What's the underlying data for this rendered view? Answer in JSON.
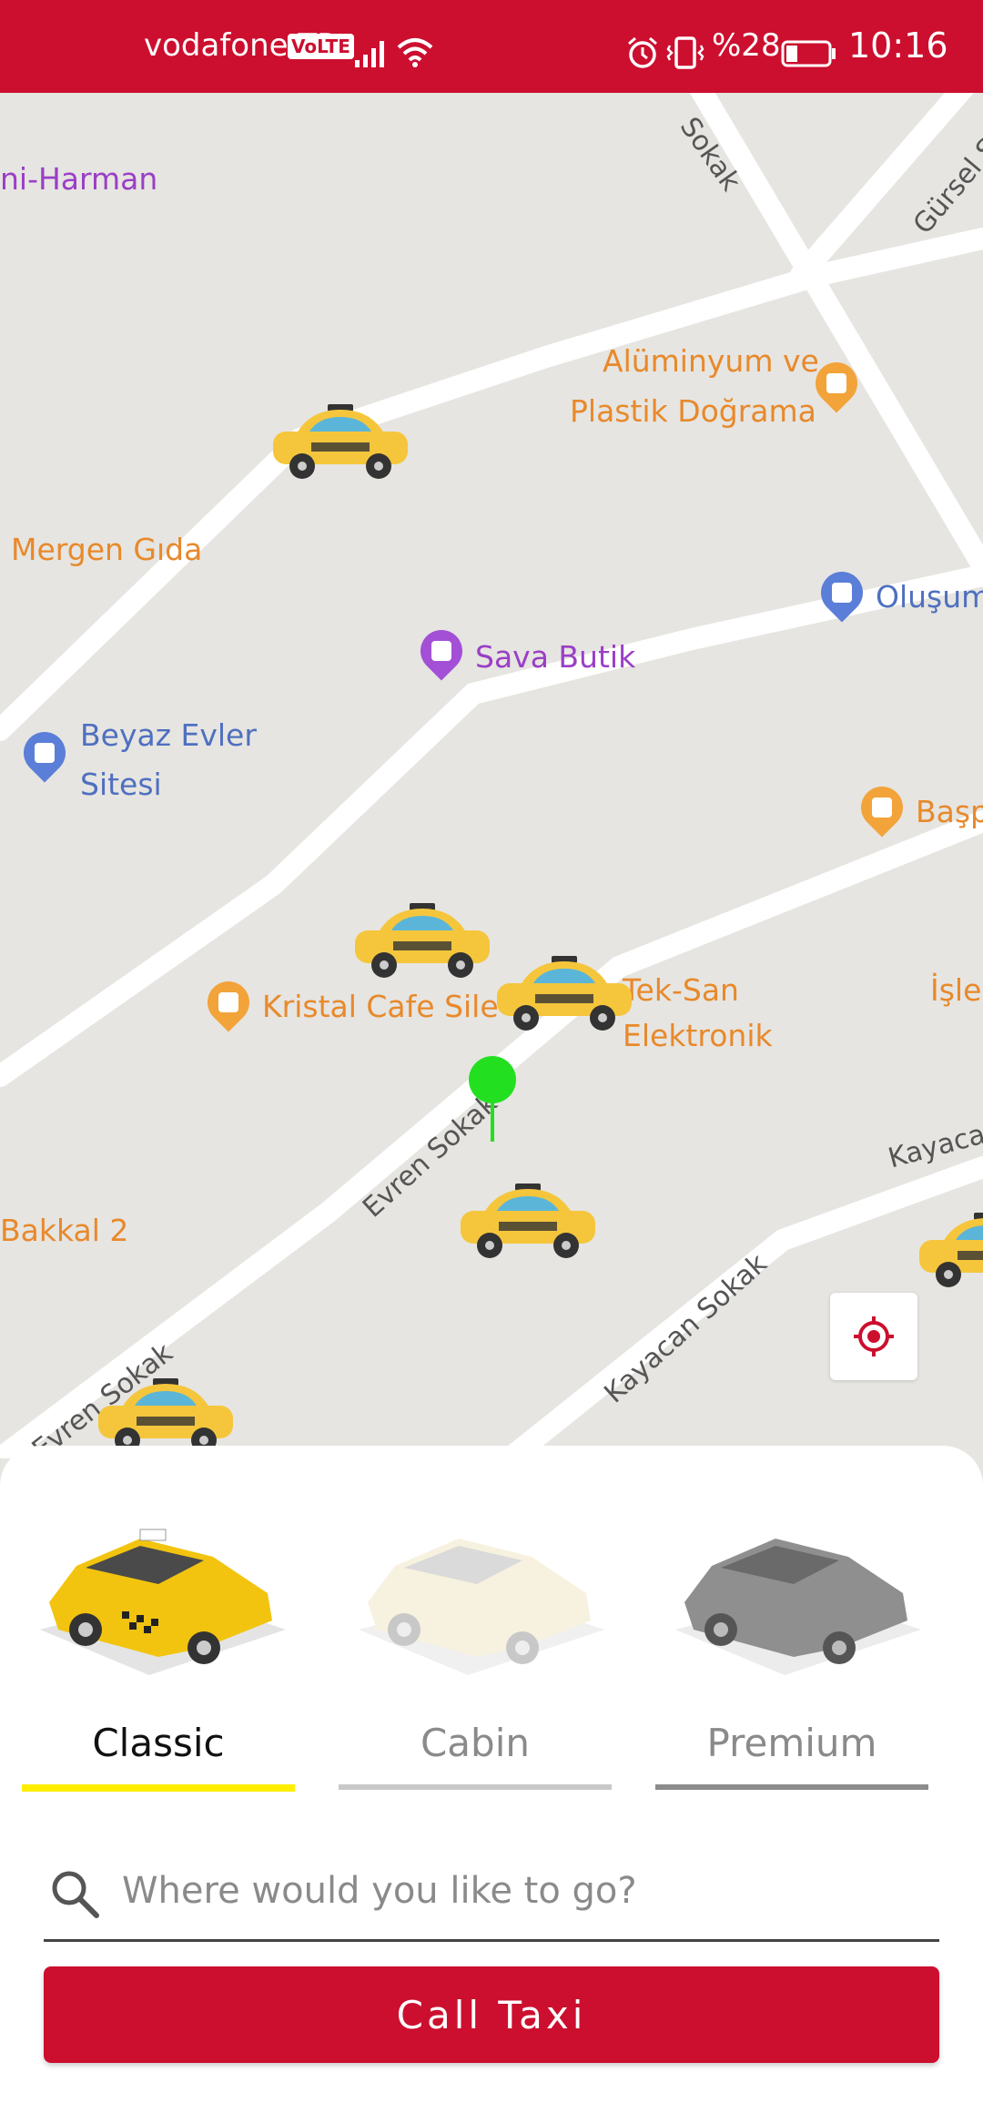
{
  "status_bar": {
    "carrier": "vodafone TR",
    "volte": "VoLTE",
    "battery": "%28",
    "time": "10:16",
    "background_color": "#cc0f2f"
  },
  "map": {
    "streets": [
      "Sokak",
      "Gürsel Sokak",
      "Evren Sokak",
      "Evren Sokak",
      "Kayacan Sokak",
      "Kayaca"
    ],
    "places": [
      {
        "name": "ni-Harman",
        "color": "#9a3fc6"
      },
      {
        "name": "Alüminyum ve",
        "color": "#e8892b"
      },
      {
        "name": "Plastik Doğrama",
        "color": "#e8892b"
      },
      {
        "name": "Mergen Gıda",
        "color": "#e8892b"
      },
      {
        "name": "Oluşum",
        "color": "#4f70c0"
      },
      {
        "name": "Sava Butik",
        "color": "#9a3fc6"
      },
      {
        "name": "Beyaz Evler",
        "color": "#4f70c0"
      },
      {
        "name": "Sitesi",
        "color": "#4f70c0"
      },
      {
        "name": "Başp",
        "color": "#e8892b"
      },
      {
        "name": "Kristal Cafe Sile",
        "color": "#e8892b"
      },
      {
        "name": "Tek-San",
        "color": "#e8892b"
      },
      {
        "name": "Elektronik",
        "color": "#e8892b"
      },
      {
        "name": "İşler",
        "color": "#e8892b"
      },
      {
        "name": "Bakkal 2",
        "color": "#e8892b"
      }
    ],
    "icons": [
      "taxi-icon",
      "current-location-pin-icon",
      "locate-me-icon"
    ]
  },
  "vehicle_types": [
    {
      "label": "Classic",
      "selected": true,
      "underline_color": "#ffee00"
    },
    {
      "label": "Cabin",
      "selected": false,
      "underline_color": "#c8c8c8"
    },
    {
      "label": "Premium",
      "selected": false,
      "underline_color": "#8c8c8c"
    }
  ],
  "search": {
    "placeholder": "Where would you like to go?",
    "value": ""
  },
  "call_button": {
    "label": "Call Taxi",
    "color": "#cc0f2f"
  }
}
